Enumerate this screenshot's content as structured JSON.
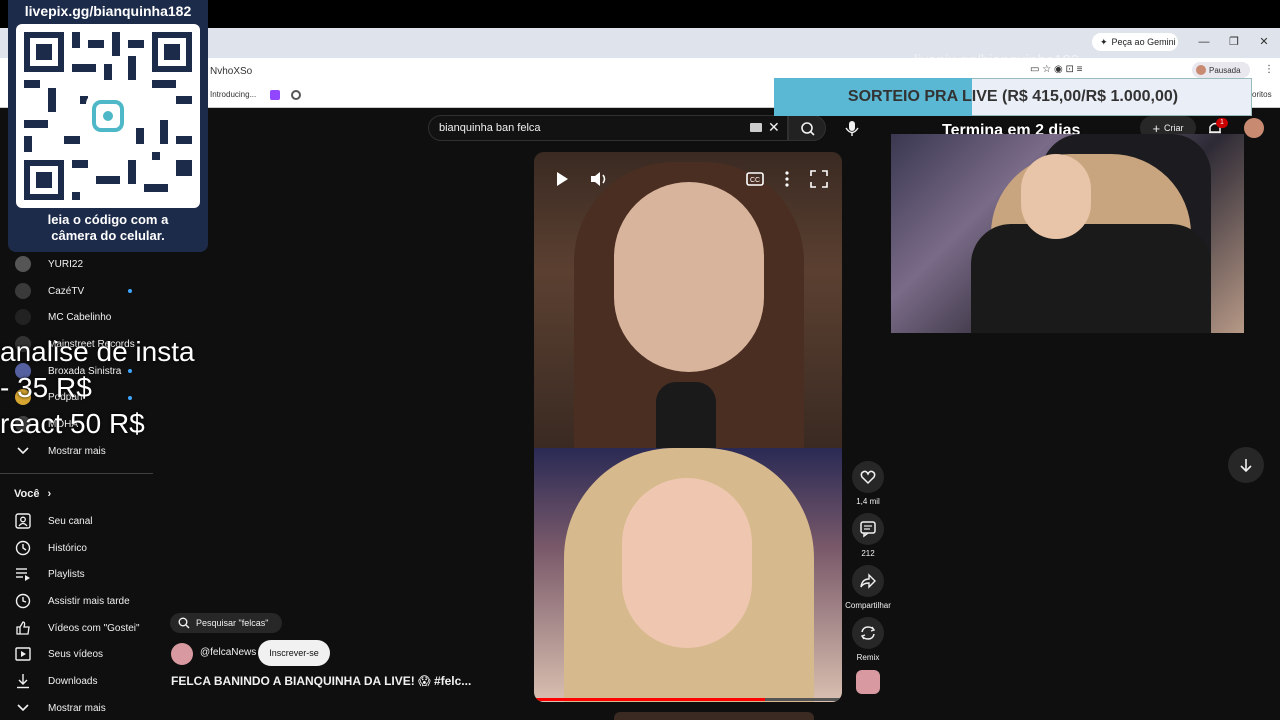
{
  "browser": {
    "gemini_label": "Peça ao Gemini",
    "url_fragment": "NvhoXSo",
    "bookmark_1": "Introducing...",
    "bookmark_right": "oritos",
    "profile_status": "Pausada"
  },
  "overlay": {
    "qr_title": "livepix.gg/bianquinha182",
    "qr_caption_line1": "leia o código com a",
    "qr_caption_line2": "câmera do celular.",
    "price_line1": "analise de insta",
    "price_line2": "- 35 R$",
    "price_line3": "react 50 R$",
    "watermark": "livepix.gg/bianquinha182",
    "sorteio": "SORTEIO PRA LIVE (R$ 415,00/R$ 1.000,00)",
    "sorteio_progress": 0.415,
    "termina": "Termina em 2 dias"
  },
  "youtube": {
    "search_value": "bianquinha ban felca",
    "criar_label": "Criar",
    "notif_count": "1",
    "sidebar": {
      "subs": [
        {
          "label": "YURI22",
          "live": false
        },
        {
          "label": "CazéTV",
          "live": true
        },
        {
          "label": "MC Cabelinho",
          "live": false
        },
        {
          "label": "Mainstreet Records",
          "live": false
        },
        {
          "label": "Broxada Sinistra",
          "live": true
        },
        {
          "label": "Podpah",
          "live": true
        },
        {
          "label": "MOHA",
          "live": false
        }
      ],
      "show_more": "Mostrar mais",
      "you_header": "Você",
      "you_items": [
        {
          "label": "Seu canal",
          "icon": "channel-icon"
        },
        {
          "label": "Histórico",
          "icon": "history-icon"
        },
        {
          "label": "Playlists",
          "icon": "playlists-icon"
        },
        {
          "label": "Assistir mais tarde",
          "icon": "watch-later-icon"
        },
        {
          "label": "Vídeos com \"Gostei\"",
          "icon": "like-icon"
        },
        {
          "label": "Seus vídeos",
          "icon": "your-videos-icon"
        },
        {
          "label": "Downloads",
          "icon": "download-icon"
        }
      ],
      "show_more_2": "Mostrar mais"
    },
    "short": {
      "search_chip": "Pesquisar \"felcas\"",
      "channel": "@felcaNews",
      "subscribe": "Inscrever-se",
      "title": "FELCA BANINDO A BIANQUINHA DA LIVE! 😱 #felc...",
      "likes": "1,4 mil",
      "comments": "212",
      "share": "Compartilhar",
      "remix": "Remix",
      "progress": 0.75
    }
  },
  "colors": {
    "accent_red": "#ff0000",
    "live_blue": "#3ea6ff",
    "sorteio_fill": "#5bb8d5"
  }
}
